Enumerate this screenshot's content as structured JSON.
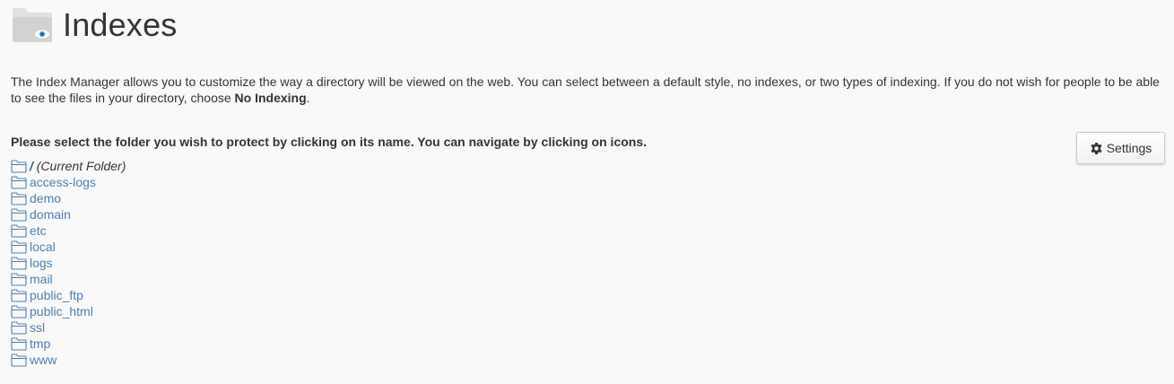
{
  "header": {
    "title": "Indexes",
    "icon": "folder-eye-icon"
  },
  "description": {
    "text_before": "The Index Manager allows you to customize the way a directory will be viewed on the web. You can select between a default style, no indexes, or two types of indexing. If you do not wish for people to be able to see the files in your directory, choose ",
    "emphasis": "No Indexing",
    "text_after": "."
  },
  "instruction": "Please select the folder you wish to protect by clicking on its name. You can navigate by clicking on icons.",
  "settings_button": {
    "label": "Settings",
    "icon": "gear-icon"
  },
  "folders": {
    "current": {
      "slash": "/",
      "label": "(Current Folder)"
    },
    "items": [
      {
        "name": "access-logs"
      },
      {
        "name": "demo"
      },
      {
        "name": "domain"
      },
      {
        "name": "etc"
      },
      {
        "name": "local"
      },
      {
        "name": "logs"
      },
      {
        "name": "mail"
      },
      {
        "name": "public_ftp"
      },
      {
        "name": "public_html"
      },
      {
        "name": "ssl"
      },
      {
        "name": "tmp"
      },
      {
        "name": "www"
      }
    ]
  },
  "colors": {
    "link": "#4a7fb5",
    "text": "#333333",
    "background": "#f9f9f9",
    "eye_accent": "#2a8fd0"
  }
}
